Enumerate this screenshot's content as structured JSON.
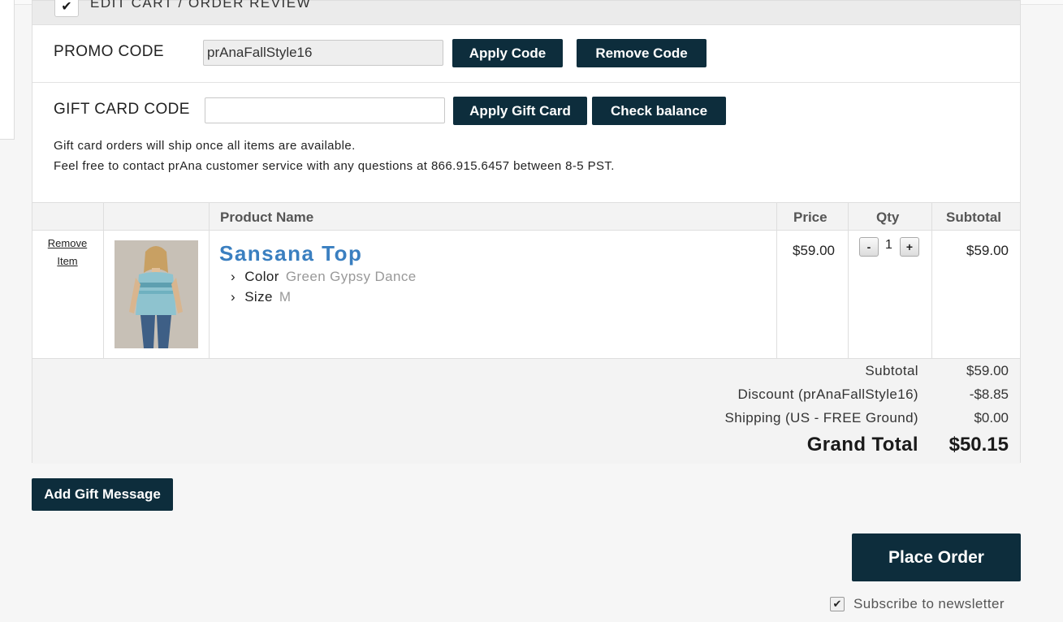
{
  "section": {
    "title": "EDIT CART / ORDER REVIEW"
  },
  "promo": {
    "label": "PROMO CODE",
    "value": "prAnaFallStyle16",
    "apply_label": "Apply Code",
    "remove_label": "Remove Code"
  },
  "gift_card": {
    "label": "GIFT CARD CODE",
    "value": "",
    "apply_label": "Apply Gift Card",
    "balance_label": "Check balance",
    "note_line1": "Gift card orders will ship once all items are available.",
    "note_line2": "Feel free to contact prAna customer service with any questions at 866.915.6457 between 8-5 PST."
  },
  "table": {
    "headers": {
      "product": "Product Name",
      "price": "Price",
      "qty": "Qty",
      "subtotal": "Subtotal"
    },
    "items": [
      {
        "remove_line1": "Remove",
        "remove_line2": "Item",
        "name": "Sansana Top",
        "options": [
          {
            "label": "Color",
            "value": "Green Gypsy Dance"
          },
          {
            "label": "Size",
            "value": "M"
          }
        ],
        "price": "$59.00",
        "qty": "1",
        "qty_minus": "-",
        "qty_plus": "+",
        "subtotal": "$59.00"
      }
    ]
  },
  "totals": {
    "subtotal_label": "Subtotal",
    "subtotal_value": "$59.00",
    "discount_label": "Discount (prAnaFallStyle16)",
    "discount_value": "-$8.85",
    "shipping_label": "Shipping (US - FREE Ground)",
    "shipping_value": "$0.00",
    "grand_label": "Grand Total",
    "grand_value": "$50.15"
  },
  "actions": {
    "gift_message_label": "Add Gift Message",
    "place_order_label": "Place Order",
    "newsletter_label": "Subscribe to newsletter",
    "newsletter_checked": true
  },
  "icons": {
    "section_check": "checkmark-icon",
    "option_chevron": "chevron-right-icon",
    "newsletter_check": "checkmark-icon"
  },
  "colors": {
    "button_bg": "#0d2d3c",
    "product_link": "#3a7fc0"
  }
}
